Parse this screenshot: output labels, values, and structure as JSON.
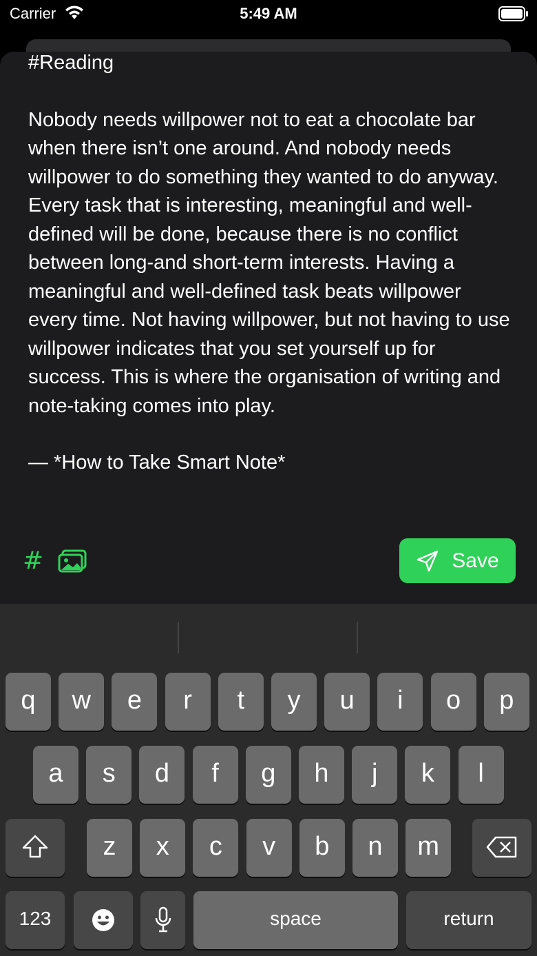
{
  "status_bar": {
    "carrier": "Carrier",
    "time": "5:49 AM"
  },
  "editor": {
    "tag_line": "#Reading",
    "body": "Nobody needs willpower not to eat a chocolate bar when there isn’t one around. And nobody needs willpower to do something they wanted to do anyway. Every task that is interesting, meaningful and well-defined will be done, because there is no conflict between long-and short-term interests. Having a meaningful and well-defined task beats willpower every time. Not having willpower, but not having to use willpower indicates that you set yourself up for success. This is where the organisation of writing and note-taking comes into play.",
    "quote": "— *How to Take Smart Note*"
  },
  "toolbar": {
    "tag_symbol": "#",
    "save_label": "Save"
  },
  "keyboard": {
    "row1": [
      "q",
      "w",
      "e",
      "r",
      "t",
      "y",
      "u",
      "i",
      "o",
      "p"
    ],
    "row2": [
      "a",
      "s",
      "d",
      "f",
      "g",
      "h",
      "j",
      "k",
      "l"
    ],
    "row3": [
      "z",
      "x",
      "c",
      "v",
      "b",
      "n",
      "m"
    ],
    "numbers_label": "123",
    "space_label": "space",
    "return_label": "return"
  },
  "colors": {
    "accent": "#30d158",
    "sheet": "#1c1c1e",
    "keyboard": "#2b2b2b"
  }
}
